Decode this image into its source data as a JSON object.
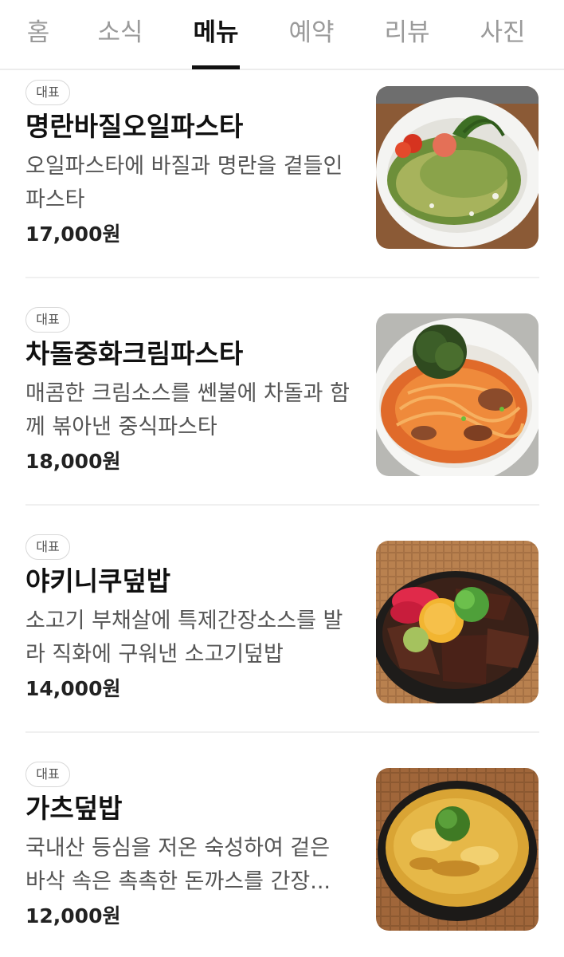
{
  "tabs": [
    {
      "label": "홈",
      "active": false
    },
    {
      "label": "소식",
      "active": false
    },
    {
      "label": "메뉴",
      "active": true
    },
    {
      "label": "예약",
      "active": false
    },
    {
      "label": "리뷰",
      "active": false
    },
    {
      "label": "사진",
      "active": false
    }
  ],
  "menu": {
    "items": [
      {
        "badge": "대표",
        "name": "명란바질오일파스타",
        "description": "오일파스타에 바질과 명란을 곁들인 파스타",
        "price": "17,000원",
        "image_icon": "basil-pasta-photo"
      },
      {
        "badge": "대표",
        "name": "차돌중화크림파스타",
        "description": "매콤한 크림소스를 쎈불에 차돌과 함께 볶아낸 중식파스타",
        "price": "18,000원",
        "image_icon": "brisket-cream-pasta-photo"
      },
      {
        "badge": "대표",
        "name": "야키니쿠덮밥",
        "description": "소고기 부채살에 특제간장소스를 발라 직화에 구워낸 소고기덮밥",
        "price": "14,000원",
        "image_icon": "yakiniku-rice-bowl-photo"
      },
      {
        "badge": "대표",
        "name": "가츠덮밥",
        "description": "국내산 등심을 저온 숙성하여 겉은 바삭 속은 촉촉한 돈까스를 간장...",
        "price": "12,000원",
        "image_icon": "katsudon-photo"
      }
    ]
  }
}
